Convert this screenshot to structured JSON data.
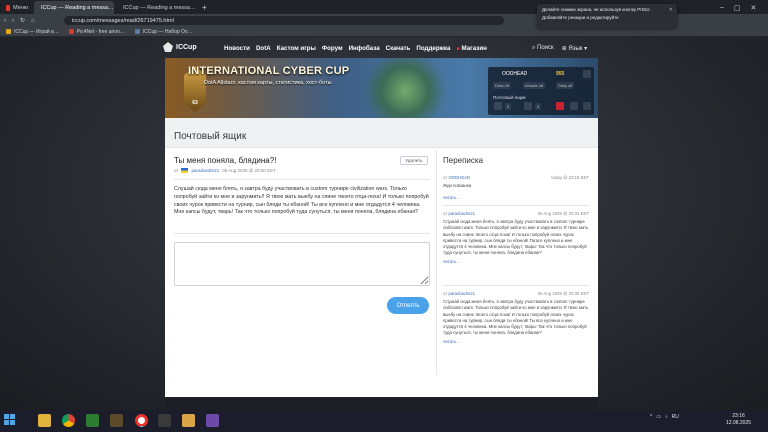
{
  "browser": {
    "tabs": [
      {
        "label": "Меню",
        "favicon": "#e8342a"
      },
      {
        "label": "ICCup — Reading a messa…",
        "favicon": "#5b7aa8"
      },
      {
        "label": "ICCup — Reading a messa…",
        "favicon": "#5b7aa8"
      }
    ],
    "new_tab": "+",
    "address": "iccup.com/messages/read/26719475.html",
    "bookmarks": [
      {
        "label": "ICCup — Играй в…",
        "favicon": "#e6a817"
      },
      {
        "label": "Pic4Net - free anon…",
        "favicon": "#d73a2a"
      },
      {
        "label": "ICCup — Набор Оо…",
        "favicon": "#5b7aa8"
      }
    ],
    "notification": {
      "line1": "Делайте снимки экрана, не используя кнопку PrtScr.",
      "line2": "Добавляйте реакции и редактируйте",
      "close": "✕"
    }
  },
  "site": {
    "logo": "ICCup",
    "nav": [
      "Новости",
      "DotA",
      "Кастом игры",
      "Форум",
      "Инфобаза",
      "Скачать",
      "Поддержка",
      "Магазин"
    ],
    "search_label": "Поиск",
    "language_label": "Язык"
  },
  "banner": {
    "title": "INTERNATIONAL CYBER CUP",
    "subtitle": "DotA Allstars: кастом карты, статистика, хост-боты",
    "badge_number": "63"
  },
  "user_panel": {
    "username": "OODHEAD",
    "coins": "955",
    "chips": [
      "Dota off",
      "Arcade off",
      "Daily off"
    ],
    "mail_label": "Почтовый ящик",
    "counts": [
      "0",
      "0"
    ]
  },
  "mailbox": {
    "title": "Почтовый ящик",
    "thread_title": "Ты меня поняла, блядина?!",
    "delete_label": "Удалить",
    "meta_from": "от",
    "meta_user": "paradoedm21",
    "meta_date": "05 Aug 2025 @ 20:50 EET",
    "body": "Слушай сюда меня блять, я завтра буду участвовать в custom турнире civilization wars. Только попробуй зайти ко мне и зарунмить!! Я твою мать выебу на спине твоего отца-лоха! И только попробуй своих чурок привести на турнир, сын бляди ты ебаной! Ты все куплено и мне отдадутся 4 человека. Мне капсы будут, тварь! Так что только попробуй туда сунуться, ты меня поняла, блядина ебаная?",
    "send_label": "Отпепть"
  },
  "sidebar": {
    "title": "Переписка",
    "conversations": [
      {
        "from": "от",
        "user": "OODHEAD",
        "date": "today @ 23:15 EET",
        "text": "Жди повзанка",
        "more": "читать..."
      },
      {
        "from": "от",
        "user": "paradoedm21",
        "date": "05 Aug 2025 @ 20:31 EET",
        "text": "Слушай сюда меня блять, я завтра буду участвовать в custom турнире civilization wars. Только попробуй зайти ко мне и зарунмить! Я твою мать выебу на спине твоего отца-лоха! И только попробуй своих чурок привести на турнир, сын бляди ты ебаной! Тагасе куплено и мне отдадутся 4 человека. Мне капсы будут, тварь! Так что только попробуй туда сунуться, ты меня поняла, блядина ебаная?",
        "more": "читать..."
      },
      {
        "from": "от",
        "user": "paradoedm21",
        "date": "05 Aug 2025 @ 20:30 EET",
        "text": "Слушай сюда меня блять, я завтра буду участвовать в custom турнире civilization wars. Только попробуй зайти ко мне и зарунмить! Я твою мать выебу на спине твоего отца-лоха! И только попробуй своих чурок привести на турнир, сын бляди ты ебаной! Ты все куплено и мне отдадутся 4 человека. Мне капсы будут, тварь! Так что только попробуй туда сунуться, ты меня поняла, блядина ебаная?",
        "more": "читать..."
      }
    ]
  },
  "taskbar": {
    "tray_lang": "RU",
    "time": "23:16",
    "date": "12.08.2025"
  }
}
